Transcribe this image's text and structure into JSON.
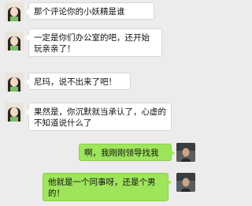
{
  "messages": [
    {
      "side": "left",
      "text": "那个评论你的小妖精是谁"
    },
    {
      "side": "left",
      "text": "一定是你们办公室的吧，还开始玩亲亲了！"
    },
    {
      "side": "left",
      "text": "尼玛，说不出来了吧！"
    },
    {
      "side": "left",
      "text": "果然是，你沉默就当承认了，心虚的不知道说什么了"
    },
    {
      "side": "right",
      "text": "啊，我刚刚领导找我"
    },
    {
      "side": "right",
      "text": "他就是一个同事呀，还是个男的！"
    }
  ],
  "colors": {
    "background": "#ececec",
    "left_bubble": "#ffffff",
    "right_bubble": "#9fe55c"
  },
  "avatars": {
    "left": "girl-avatar-icon",
    "right": "man-avatar-icon"
  }
}
